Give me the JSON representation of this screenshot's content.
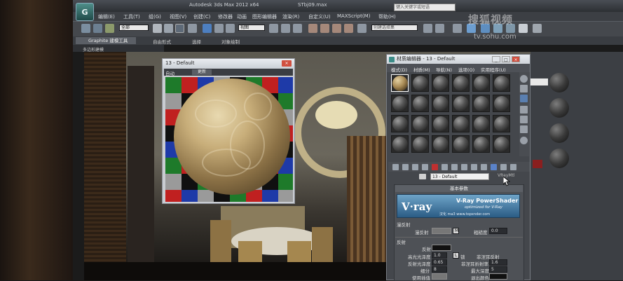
{
  "app": {
    "title": "Autodesk 3ds Max  2012 x64",
    "file": "STbj09.max",
    "logo": "3ds Max logo",
    "search_placeholder": "键入关键字或短语"
  },
  "menu": {
    "items": [
      "编辑(E)",
      "工具(T)",
      "组(G)",
      "视图(V)",
      "创建(C)",
      "修改器",
      "动画",
      "图形编辑器",
      "渲染(R)",
      "自定义(U)",
      "MAXScript(M)",
      "帮助(H)"
    ]
  },
  "toolbar": {
    "selection_filter": "全部",
    "view_coord": "视图",
    "named_selection": "创建选择集"
  },
  "ribbon": {
    "tabs": [
      "Graphite 建模工具",
      "自由形式",
      "选择",
      "对象绘制"
    ],
    "sub_label": "多边形建模"
  },
  "preview_window": {
    "title": "13 - Default",
    "close": "×",
    "auto_label": "自动",
    "update_label": "更新"
  },
  "material_editor": {
    "title": "材质编辑器 - 13 - Default",
    "menus": [
      "模式(D)",
      "材质(M)",
      "导航(N)",
      "选项(O)",
      "实用程序(U)"
    ],
    "material_name": "13 - Default",
    "shader_type": "VRayMtl",
    "rollout_title": "基本参数",
    "banner": {
      "logo": "V·ray",
      "title": "V-Ray PowerShader",
      "subtitle": "optimized for V-Ray",
      "credit": "汉化 ma3 www.topxnder.com"
    },
    "diffuse": {
      "section": "漫反射",
      "diffuse_label": "漫反射",
      "map_btn": "M",
      "roughness_label": "粗糙度",
      "roughness_value": "0.0"
    },
    "reflection": {
      "section": "反射",
      "reflect_label": "反射",
      "hilight_gloss_label": "高光光泽度",
      "hilight_gloss_value": "1.0",
      "lock_label": "L",
      "lock_text": "锁",
      "fresnel_label": "菲涅耳反射",
      "refl_gloss_label": "反射光泽度",
      "refl_gloss_value": "0.65",
      "fresnel_ior_label": "菲涅耳折射率",
      "fresnel_ior_value": "1.6",
      "subdivs_label": "细分",
      "subdivs_value": "8",
      "max_depth_label": "最大深度",
      "max_depth_value": "5",
      "interp_label": "使用插值",
      "exit_color_label": "退出颜色"
    }
  },
  "watermark": {
    "line1": "搜狐视频",
    "line2": "tv.sohu.com"
  }
}
